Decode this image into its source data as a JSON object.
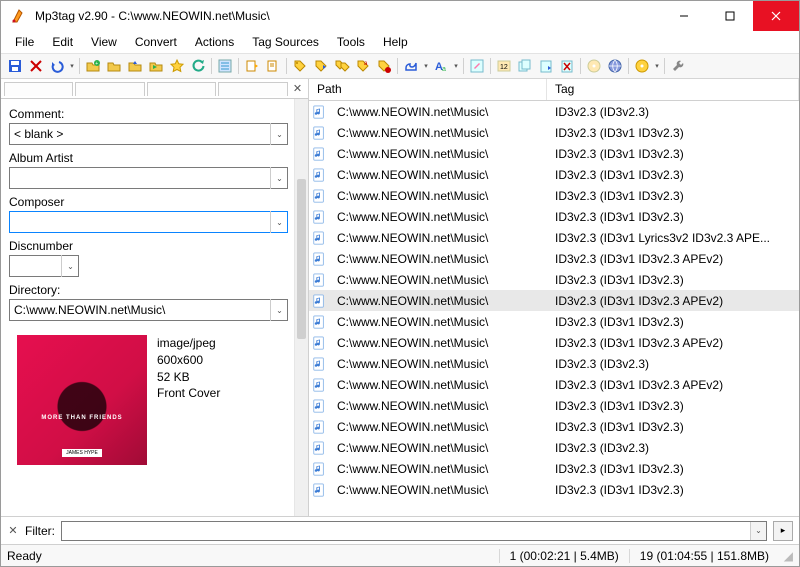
{
  "title": "Mp3tag v2.90  -  C:\\www.NEOWIN.net\\Music\\",
  "menu": [
    "File",
    "Edit",
    "View",
    "Convert",
    "Actions",
    "Tag Sources",
    "Tools",
    "Help"
  ],
  "fields": {
    "comment_label": "Comment:",
    "comment_value": "< blank >",
    "albumartist_label": "Album Artist",
    "albumartist_value": "",
    "composer_label": "Composer",
    "composer_value": "",
    "disc_label": "Discnumber",
    "disc_value": "",
    "directory_label": "Directory:",
    "directory_value": "C:\\www.NEOWIN.net\\Music\\"
  },
  "cover": {
    "mime": "image/jpeg",
    "dims": "600x600",
    "size": "52 KB",
    "type": "Front Cover",
    "text": "MORE THAN FRIENDS",
    "badge": "JAMES HYPE"
  },
  "columns": {
    "path": "Path",
    "tag": "Tag"
  },
  "rows": [
    {
      "path": "C:\\www.NEOWIN.net\\Music\\",
      "tag": "ID3v2.3 (ID3v2.3)"
    },
    {
      "path": "C:\\www.NEOWIN.net\\Music\\",
      "tag": "ID3v2.3 (ID3v1 ID3v2.3)"
    },
    {
      "path": "C:\\www.NEOWIN.net\\Music\\",
      "tag": "ID3v2.3 (ID3v1 ID3v2.3)"
    },
    {
      "path": "C:\\www.NEOWIN.net\\Music\\",
      "tag": "ID3v2.3 (ID3v1 ID3v2.3)"
    },
    {
      "path": "C:\\www.NEOWIN.net\\Music\\",
      "tag": "ID3v2.3 (ID3v1 ID3v2.3)"
    },
    {
      "path": "C:\\www.NEOWIN.net\\Music\\",
      "tag": "ID3v2.3 (ID3v1 ID3v2.3)"
    },
    {
      "path": "C:\\www.NEOWIN.net\\Music\\",
      "tag": "ID3v2.3 (ID3v1 Lyrics3v2 ID3v2.3 APE..."
    },
    {
      "path": "C:\\www.NEOWIN.net\\Music\\",
      "tag": "ID3v2.3 (ID3v1 ID3v2.3 APEv2)"
    },
    {
      "path": "C:\\www.NEOWIN.net\\Music\\",
      "tag": "ID3v2.3 (ID3v1 ID3v2.3)"
    },
    {
      "path": "C:\\www.NEOWIN.net\\Music\\",
      "tag": "ID3v2.3 (ID3v1 ID3v2.3 APEv2)",
      "selected": true
    },
    {
      "path": "C:\\www.NEOWIN.net\\Music\\",
      "tag": "ID3v2.3 (ID3v1 ID3v2.3)"
    },
    {
      "path": "C:\\www.NEOWIN.net\\Music\\",
      "tag": "ID3v2.3 (ID3v1 ID3v2.3 APEv2)"
    },
    {
      "path": "C:\\www.NEOWIN.net\\Music\\",
      "tag": "ID3v2.3 (ID3v2.3)"
    },
    {
      "path": "C:\\www.NEOWIN.net\\Music\\",
      "tag": "ID3v2.3 (ID3v1 ID3v2.3 APEv2)"
    },
    {
      "path": "C:\\www.NEOWIN.net\\Music\\",
      "tag": "ID3v2.3 (ID3v1 ID3v2.3)"
    },
    {
      "path": "C:\\www.NEOWIN.net\\Music\\",
      "tag": "ID3v2.3 (ID3v1 ID3v2.3)"
    },
    {
      "path": "C:\\www.NEOWIN.net\\Music\\",
      "tag": "ID3v2.3 (ID3v2.3)"
    },
    {
      "path": "C:\\www.NEOWIN.net\\Music\\",
      "tag": "ID3v2.3 (ID3v1 ID3v2.3)"
    },
    {
      "path": "C:\\www.NEOWIN.net\\Music\\",
      "tag": "ID3v2.3 (ID3v1 ID3v2.3)"
    }
  ],
  "filter": {
    "label": "Filter:",
    "value": ""
  },
  "status": {
    "ready": "Ready",
    "selection": "1 (00:02:21 | 5.4MB)",
    "total": "19 (01:04:55 | 151.8MB)"
  }
}
